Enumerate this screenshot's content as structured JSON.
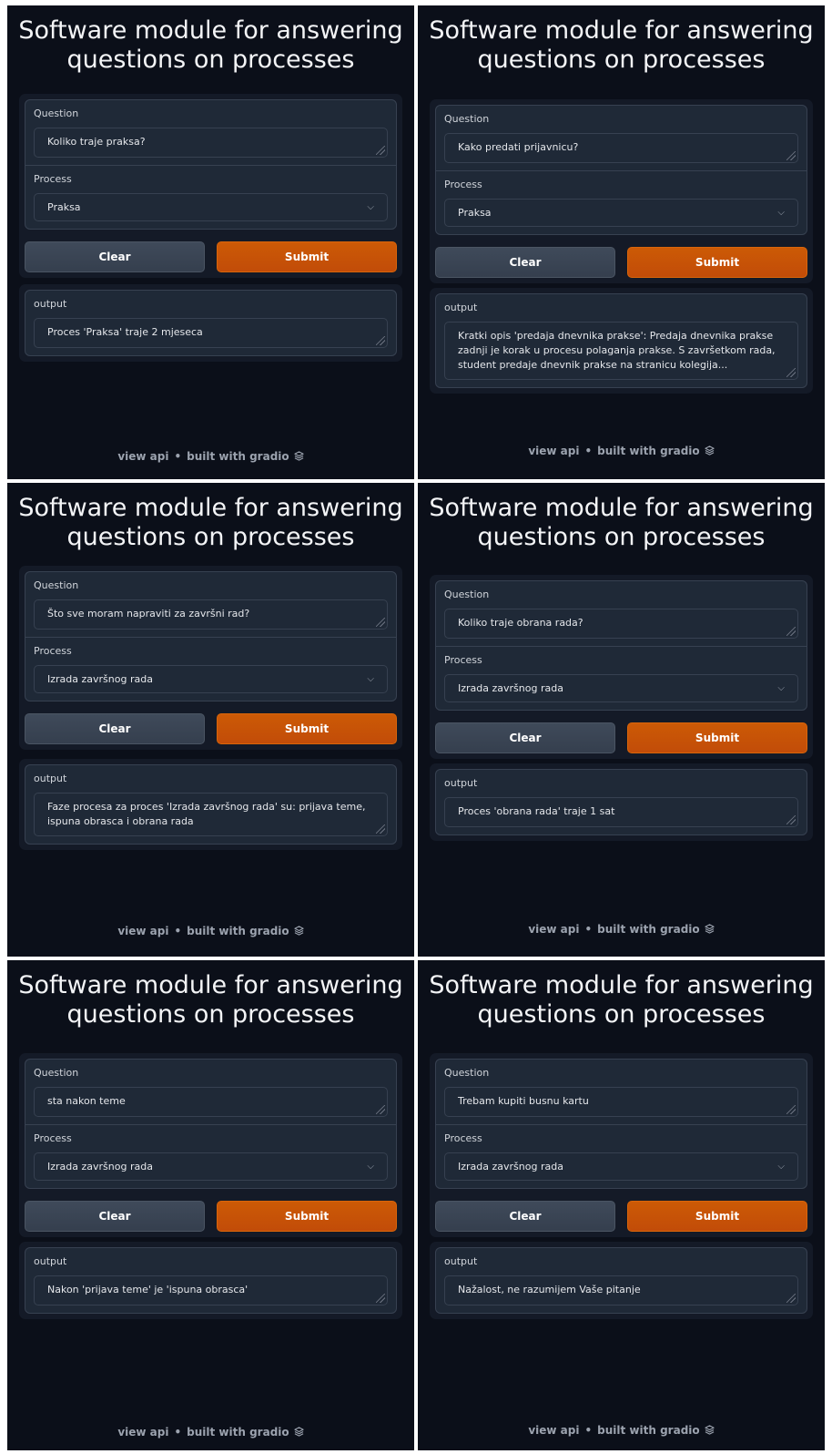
{
  "app": {
    "title": "Software module for answering\nquestions on processes",
    "question_label": "Question",
    "process_label": "Process",
    "output_label": "output",
    "clear_label": "Clear",
    "submit_label": "Submit",
    "footer_api": "view api",
    "footer_sep": "•",
    "footer_built": "built with gradio"
  },
  "panels": [
    {
      "question": "Koliko traje praksa?",
      "process": "Praksa",
      "output": "Proces 'Praksa' traje 2 mjeseca"
    },
    {
      "question": "Kako predati prijavnicu?",
      "process": "Praksa",
      "output": "Kratki opis 'predaja dnevnika prakse': Predaja dnevnika prakse zadnji je korak u procesu polaganja prakse. S završetkom rada, student predaje dnevnik prakse na stranicu kolegija..."
    },
    {
      "question": "Što sve moram napraviti za završni rad?",
      "process": "Izrada završnog rada",
      "output": "Faze procesa za proces 'Izrada završnog rada' su: prijava teme, ispuna obrasca i obrana rada"
    },
    {
      "question": "Koliko traje obrana rada?",
      "process": "Izrada završnog rada",
      "output": "Proces 'obrana rada' traje 1 sat"
    },
    {
      "question": "sta nakon teme",
      "process": "Izrada završnog rada",
      "output": "Nakon 'prijava teme' je 'ispuna obrasca'"
    },
    {
      "question": "Trebam kupiti busnu kartu",
      "process": "Izrada završnog rada",
      "output": "Nažalost, ne razumijem Vaše pitanje"
    }
  ]
}
